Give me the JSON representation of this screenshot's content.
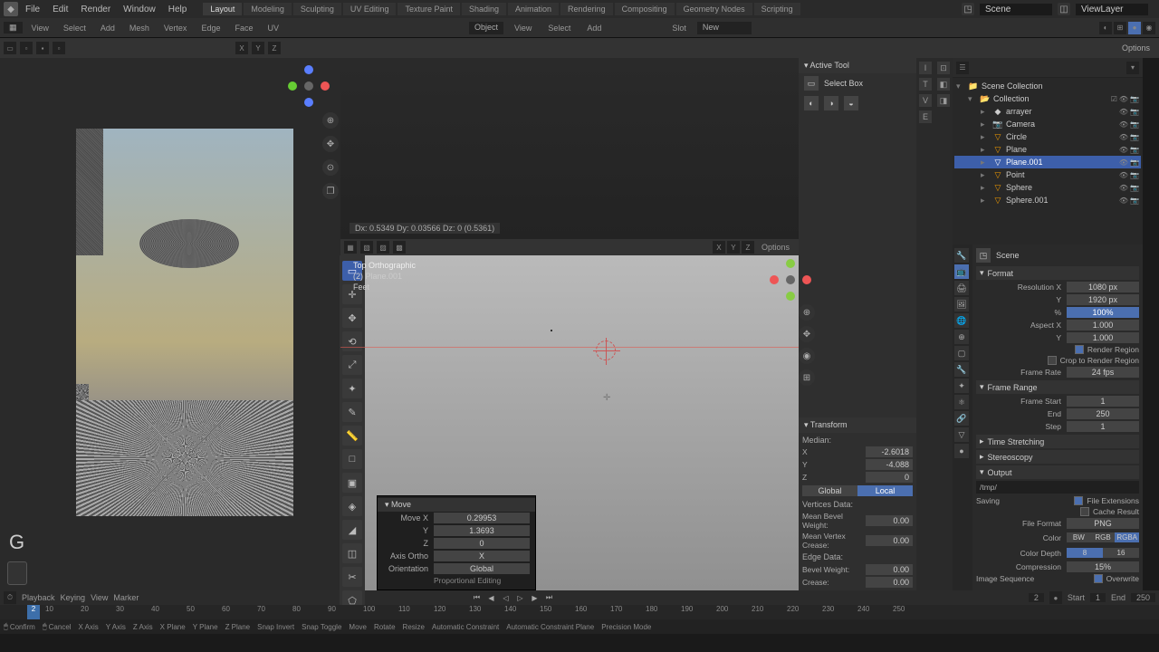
{
  "menu": {
    "items": [
      "File",
      "Edit",
      "Render",
      "Window",
      "Help"
    ]
  },
  "tabs": [
    "Layout",
    "Modeling",
    "Sculpting",
    "UV Editing",
    "Texture Paint",
    "Shading",
    "Animation",
    "Rendering",
    "Compositing",
    "Geometry Nodes",
    "Scripting"
  ],
  "scene": {
    "name": "Scene",
    "layer": "ViewLayer"
  },
  "header2": {
    "items": [
      "View",
      "Select",
      "Add",
      "Mesh",
      "Vertex",
      "Edge",
      "Face",
      "UV"
    ],
    "obj_mode": "Object",
    "slot": "Slot",
    "new": "New"
  },
  "header3": {
    "axes": [
      "X",
      "Y",
      "Z"
    ],
    "options": "Options"
  },
  "render_tools": [
    "⊕",
    "✥",
    "⊙",
    "❐"
  ],
  "active_tool": {
    "title": "Active Tool",
    "mode": "Select Box"
  },
  "transform": {
    "title": "Transform",
    "median": "Median:",
    "X": "-2.6018",
    "Y": "-4.088",
    "Z": "0",
    "seg": [
      "Global",
      "Local"
    ],
    "vdata": "Vertices Data:",
    "bevelw_l": "Mean Bevel Weight:",
    "bevelw": "0.00",
    "vcrease_l": "Mean Vertex Crease:",
    "vcrease": "0.00",
    "edata": "Edge Data:",
    "ebevel_l": "Bevel Weight:",
    "ebevel": "0.00",
    "ecrease_l": "Crease:",
    "ecrease": "0.00"
  },
  "side_vtabs": [
    "Item",
    "Tool",
    "View",
    "Edit",
    "Screencast Keys"
  ],
  "viewport": {
    "coord": "Dx: 0.5349   Dy: 0.03566   Dz: 0 (0.5361)",
    "line1": "Top Orthographic",
    "line2": "(2) Plane.001",
    "line3": "Feet"
  },
  "key_hint": "G",
  "move_panel": {
    "title": "Move",
    "move_x_l": "Move X",
    "move_x": "0.29953",
    "move_y_l": "Y",
    "move_y": "1.3693",
    "move_z_l": "Z",
    "move_z": "0",
    "axis_l": "Axis Ortho",
    "axis": "X",
    "orient_l": "Orientation",
    "orient": "Global",
    "prop": "Proportional Editing"
  },
  "outliner": {
    "root": "Scene Collection",
    "collection": "Collection",
    "items": [
      "arrayer",
      "Camera",
      "Circle",
      "Plane",
      "Plane.001",
      "Point",
      "Sphere",
      "Sphere.001"
    ],
    "selected": "Plane.001"
  },
  "props_scene": "Scene",
  "format": {
    "title": "Format",
    "resx_l": "Resolution X",
    "resx": "1080 px",
    "resy_l": "Y",
    "resy": "1920 px",
    "pct_l": "%",
    "pct": "100%",
    "aspect_l": "Aspect X",
    "aspect_x": "1.000",
    "aspect_y": "1.000",
    "rr": "Render Region",
    "crop": "Crop to Render Region",
    "fps_l": "Frame Rate",
    "fps": "24 fps"
  },
  "frange": {
    "title": "Frame Range",
    "start_l": "Frame Start",
    "start": "1",
    "end_l": "End",
    "end": "250",
    "step_l": "Step",
    "step": "1"
  },
  "tstretch": "Time Stretching",
  "stereo": "Stereoscopy",
  "output": {
    "title": "Output",
    "path": "/tmp/",
    "saving_l": "Saving",
    "fe": "File Extensions",
    "cr": "Cache Result",
    "fmt_l": "File Format",
    "fmt": "PNG",
    "color_l": "Color",
    "colors": [
      "BW",
      "RGB",
      "RGBA"
    ],
    "depth_l": "Color Depth",
    "depths": [
      "8",
      "16"
    ],
    "comp_l": "Compression",
    "comp": "15%",
    "imgseq_l": "Image Sequence",
    "ow": "Overwrite"
  },
  "timeline": {
    "controls": [
      "Playback",
      "Keying",
      "View",
      "Marker"
    ],
    "ticks": [
      "10",
      "20",
      "30",
      "40",
      "50",
      "60",
      "70",
      "80",
      "90",
      "100",
      "110",
      "120",
      "130",
      "140",
      "150",
      "160",
      "170",
      "180",
      "190",
      "200",
      "210",
      "220",
      "230",
      "240",
      "250"
    ],
    "playhead": "2",
    "start_l": "Start",
    "start": "1",
    "end_l": "End",
    "end": "250"
  },
  "status": [
    "Confirm",
    "Cancel",
    "X Axis",
    "Y Axis",
    "Z Axis",
    "X Plane",
    "Y Plane",
    "Z Plane",
    "Snap Invert",
    "Snap Toggle",
    "Move",
    "Rotate",
    "Resize",
    "Automatic Constraint",
    "Automatic Constraint Plane",
    "Precision Mode"
  ]
}
